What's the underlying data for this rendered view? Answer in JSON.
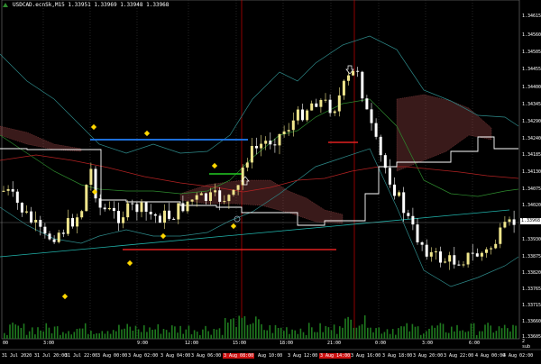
{
  "window": {
    "title": "USDCAD.ecnSk,M15",
    "ohlc": "1.33951 1.33969 1.33948 1.33968"
  },
  "price_axis": {
    "labels": [
      "1.34615",
      "1.34560",
      "1.34505",
      "1.34455",
      "1.34400",
      "1.34345",
      "1.34290",
      "1.34240",
      "1.34185",
      "1.34130",
      "1.34075",
      "1.34020",
      "1.33968",
      "1.33930",
      "1.33875",
      "1.33820",
      "1.33765",
      "1.33715",
      "1.33660",
      "1.33605"
    ],
    "current_price": "1.33968"
  },
  "time_axis": {
    "top_labels": [
      "00",
      "3:00",
      "9:00",
      "12:00",
      "15:00",
      "18:00",
      "21:00",
      "0:00",
      "3:00",
      "6:00"
    ],
    "bottom_labels": [
      "31 Jul 2020",
      "31 Jul 20:00",
      "31 Jul 22:00",
      "3 Aug 00:00",
      "3 Aug 02:00",
      "3 Aug 04:00",
      "3 Aug 06:00",
      "3 Aug 08:00",
      "Aug 10:00",
      "3 Aug 12:00",
      "3 Aug 14:00",
      "3 Aug 16:00",
      "3 Aug 18:00",
      "3 Aug 20:00",
      "3 Aug 22:00",
      "4 Aug 00:00",
      "4 Aug 02:00"
    ],
    "highlighted_labels": [
      "3 Aug 08:00",
      "3 Aug 14:00"
    ],
    "volume_scale": [
      "2",
      "sub"
    ]
  },
  "colors": {
    "background": "#000000",
    "candle_bull": "#f0e68c",
    "candle_bear": "#ffffff",
    "session_line": "#cc0000",
    "bollinger": "#2e8b8b",
    "ma_red": "#b22222",
    "ma_green": "#2e8b2e",
    "kumo": "#cd5c5c",
    "kijun": "#ffffff",
    "trend_line": "#20b2aa",
    "resistance_line": "#1e6fd9",
    "support_line": "#e02020",
    "entry_line": "#22cc22",
    "signal_dot": "#ffd700",
    "volume": "#1f7a1f"
  }
}
